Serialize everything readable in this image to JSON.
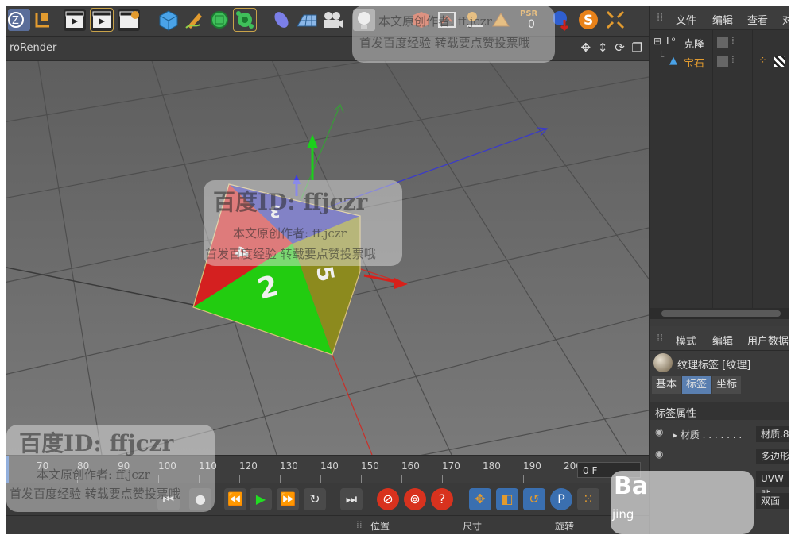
{
  "viewport": {
    "renderer_label": "roRender",
    "nav_icons": "✥ ↕ ⟳ ❐"
  },
  "toolbar": {
    "psr_label": "PSR",
    "psr_value": "0"
  },
  "timeline": {
    "ticks": [
      "70",
      "80",
      "90",
      "100",
      "110",
      "120",
      "130",
      "140",
      "150",
      "160",
      "170",
      "180",
      "190",
      "200"
    ],
    "current_frame": "0 F"
  },
  "transport": {
    "key_p": "P"
  },
  "bottom": {
    "position": "位置",
    "size": "尺寸",
    "rotation": "旋转"
  },
  "object_manager": {
    "menu": [
      "文件",
      "编辑",
      "查看",
      "对"
    ],
    "objects": [
      {
        "name": "克隆",
        "icon": "cloner-icon"
      },
      {
        "name": "宝石",
        "icon": "gem-icon"
      }
    ]
  },
  "attribute_manager": {
    "menu": [
      "模式",
      "编辑",
      "用户数据"
    ],
    "tag_title": "纹理标签 [纹理]",
    "tabs": [
      "基本",
      "标签",
      "坐标"
    ],
    "active_tab": "标签",
    "section": "标签属性",
    "material_label": "▸ 材质 . . . . . . .",
    "fields": [
      "材质.8",
      "多边形",
      "UVW 贴",
      "双面"
    ]
  },
  "watermarks": {
    "top_line": "本文原创作者: ff.jczr",
    "top_line2": "首发百度经验 转载要点赞投票哦",
    "center_id": "百度ID: ffjczr",
    "center_line": "本文原创作者: ff.jczr",
    "center_line2": "首发百度经验 转载要点赞投票哦",
    "bottom_id": "百度ID: ffjczr",
    "bottom_line": "本文原创作者: ff.jczr",
    "bottom_line2": "首发百度经验 转载要点赞投票哦",
    "baidu_logo": "Ba",
    "baidu_sub": "jing"
  },
  "colors": {
    "accent_orange": "#e29b2f",
    "panel_dark": "#333333",
    "viewport": "#6b6b6b"
  }
}
